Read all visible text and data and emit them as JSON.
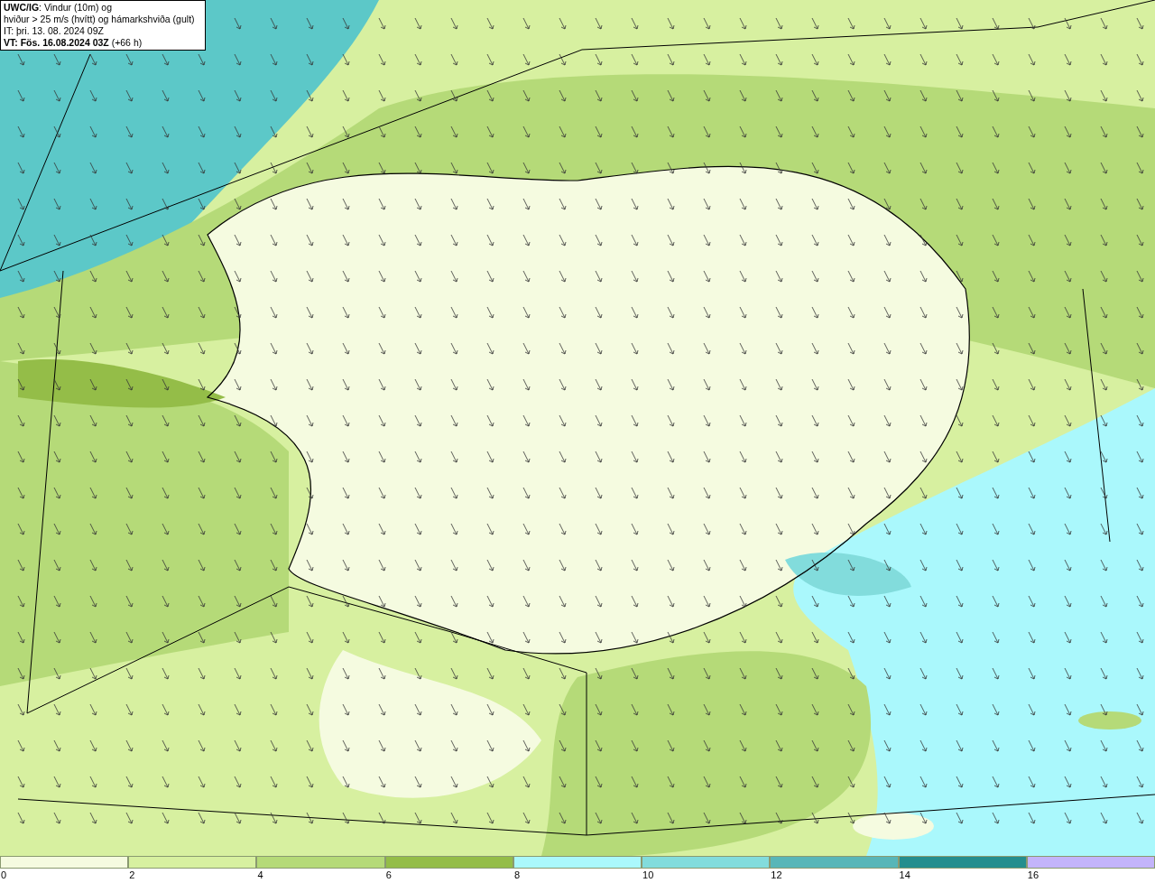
{
  "title_box": {
    "lines": [
      "**UWC/IG**: Vindur (10m) og",
      "hviður > 25 m/s (hvítt) og hámarkshviða (gult)",
      "IT: þri. 13. 08. 2024 09Z",
      "**VT: Fös. 16.08.2024 03Z** (+66 h)"
    ]
  },
  "legend": [
    {
      "label": "0",
      "color": "#f5fbe0"
    },
    {
      "label": "2",
      "color": "#d7f0a0"
    },
    {
      "label": "4",
      "color": "#b5da78"
    },
    {
      "label": "6",
      "color": "#94bd48"
    },
    {
      "label": "8",
      "color": "#aaf8fc"
    },
    {
      "label": "10",
      "color": "#82dcdc"
    },
    {
      "label": "12",
      "color": "#58b6b8"
    },
    {
      "label": "14",
      "color": "#248e8e"
    },
    {
      "label": "16",
      "color": "#c3b4fa"
    }
  ]
}
